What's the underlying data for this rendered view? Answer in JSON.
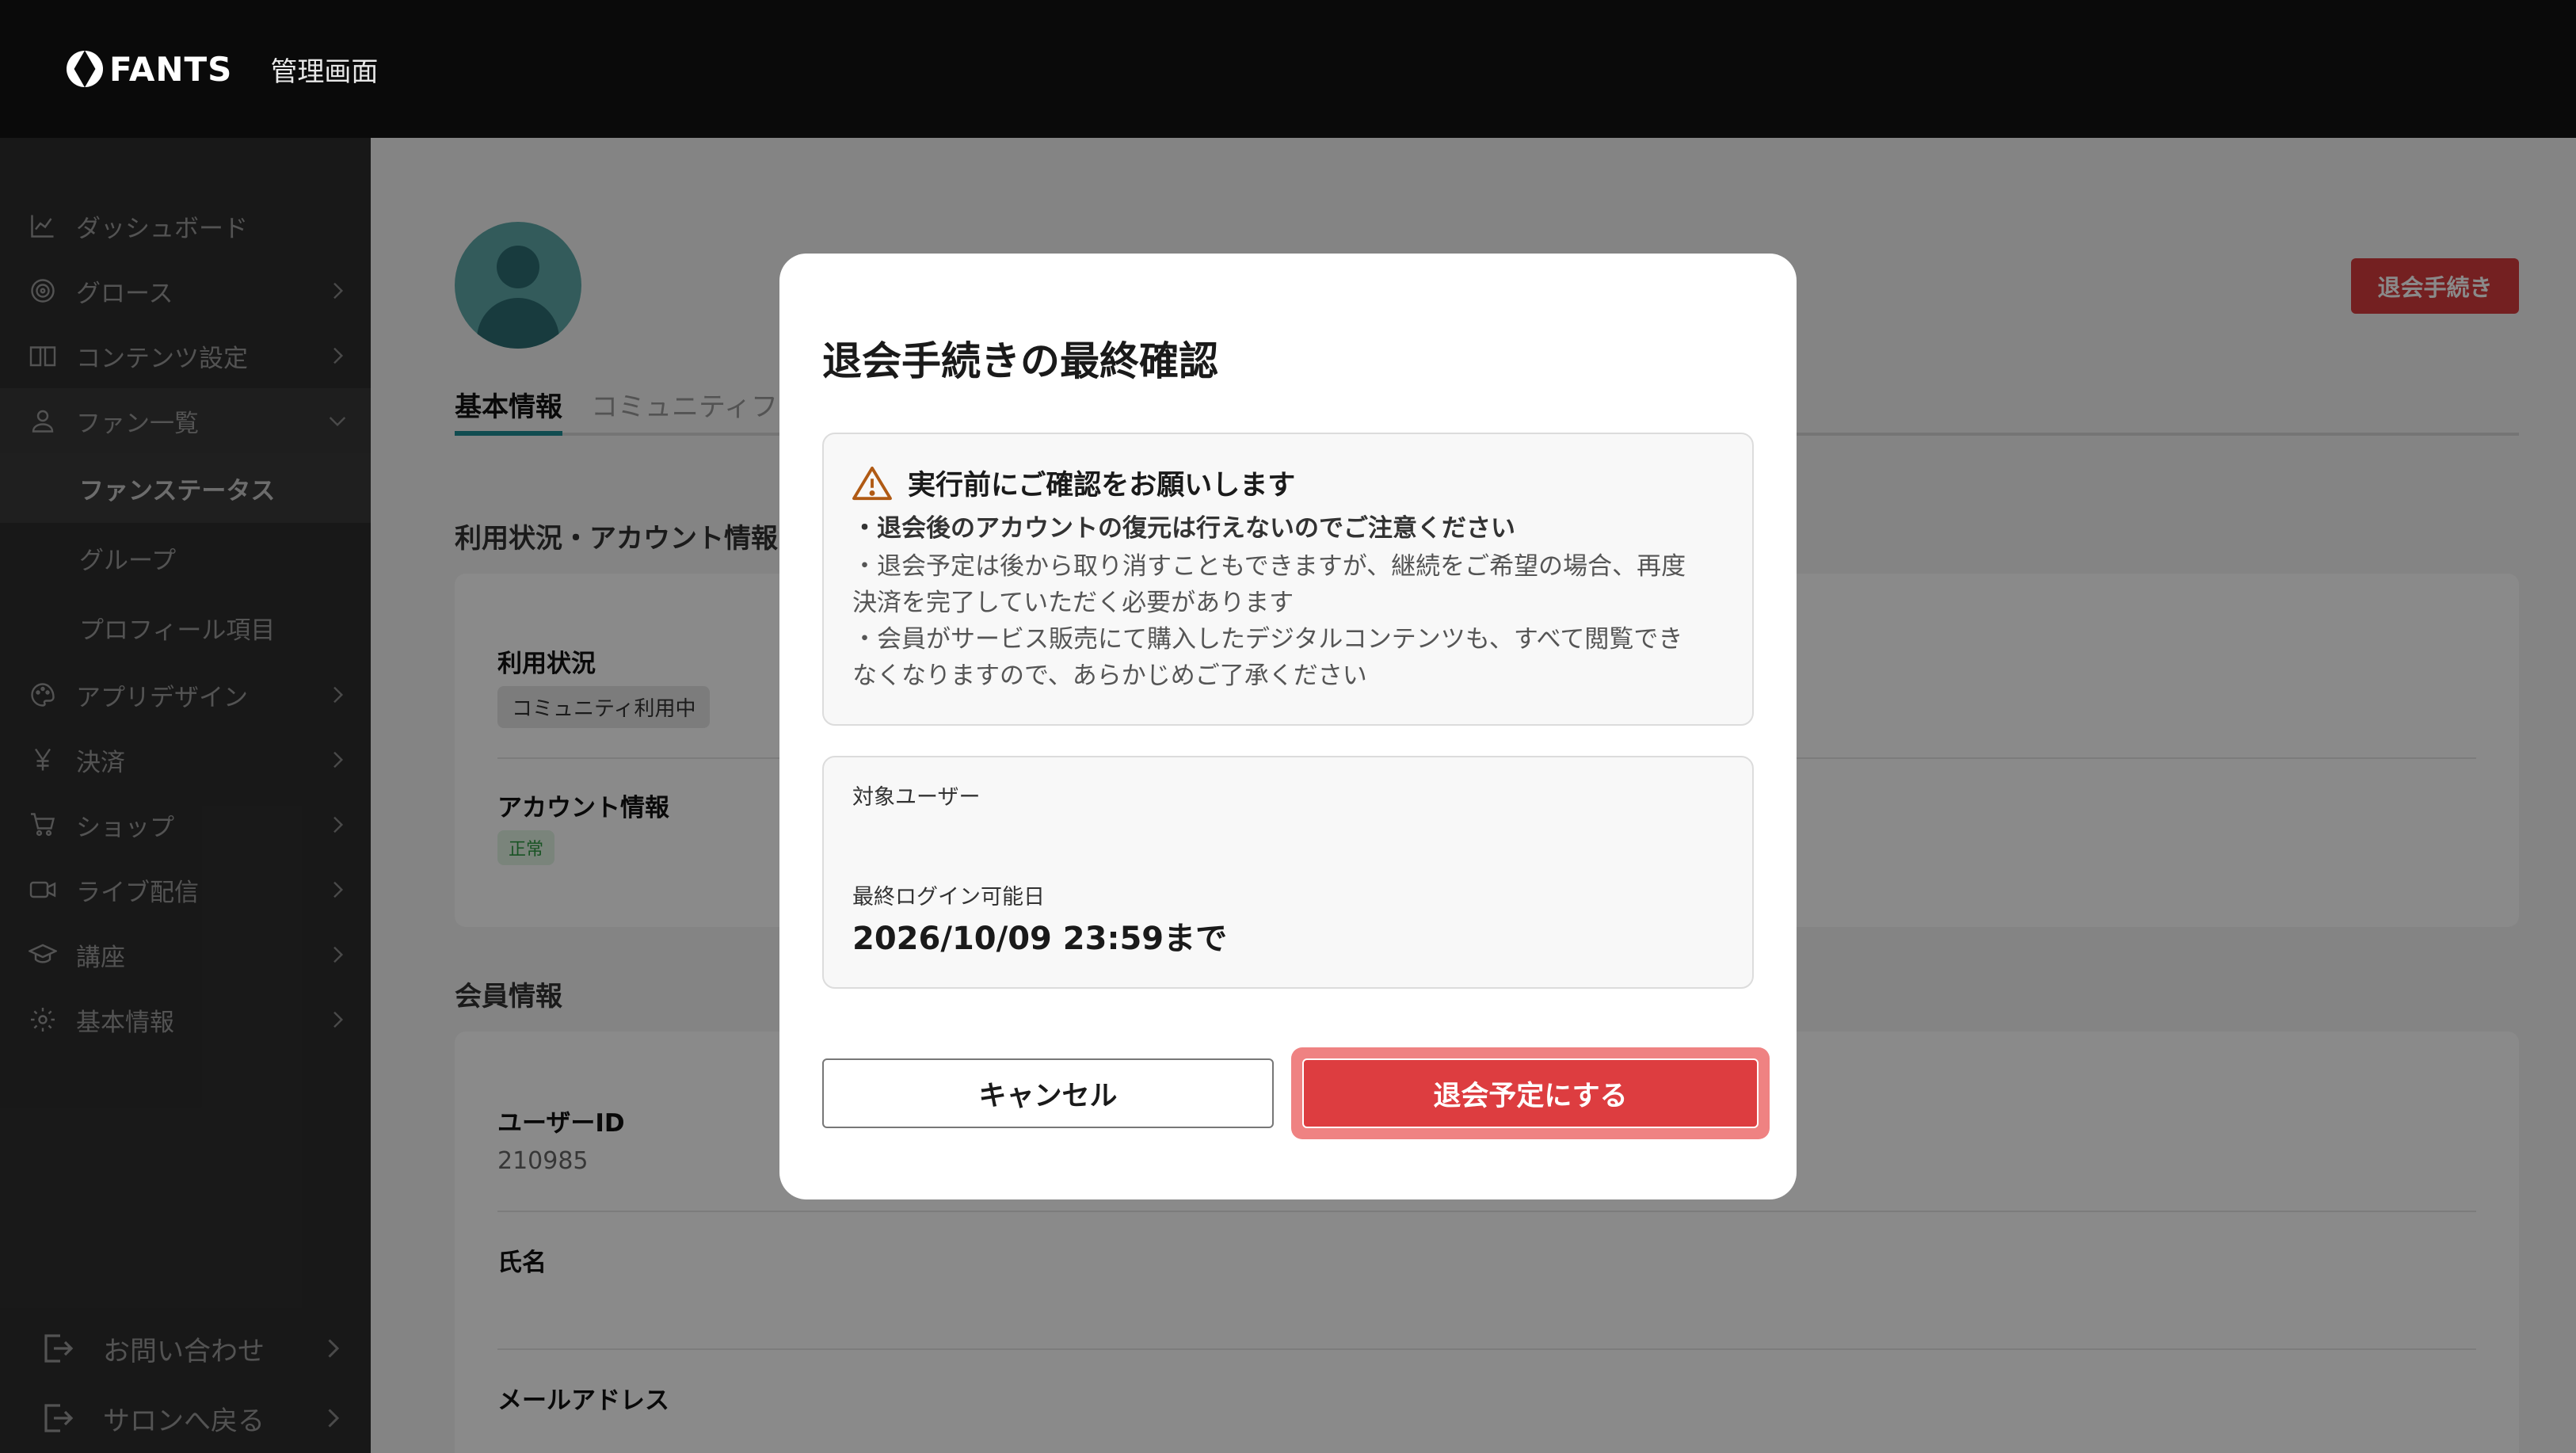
{
  "header": {
    "logo_text": "FANTS",
    "title": "管理画面"
  },
  "sidebar": {
    "items": [
      {
        "label": "ダッシュボード",
        "icon": "chart-line-icon",
        "has_chevron": false
      },
      {
        "label": "グロース",
        "icon": "target-icon",
        "has_chevron": true
      },
      {
        "label": "コンテンツ設定",
        "icon": "book-icon",
        "has_chevron": true
      },
      {
        "label": "ファン一覧",
        "icon": "user-icon",
        "has_chevron": true,
        "expanded": true
      },
      {
        "label": "アプリデザイン",
        "icon": "palette-icon",
        "has_chevron": true
      },
      {
        "label": "決済",
        "icon": "yen-icon",
        "has_chevron": true
      },
      {
        "label": "ショップ",
        "icon": "cart-icon",
        "has_chevron": true
      },
      {
        "label": "ライブ配信",
        "icon": "video-icon",
        "has_chevron": true
      },
      {
        "label": "講座",
        "icon": "graduation-cap-icon",
        "has_chevron": true
      },
      {
        "label": "基本情報",
        "icon": "gear-icon",
        "has_chevron": true
      }
    ],
    "sub_items": [
      "ファンステータス",
      "グループ",
      "プロフィール項目"
    ],
    "bottom_items": [
      "お問い合わせ",
      "サロンへ戻る"
    ]
  },
  "main": {
    "withdraw_button": "退会手続き",
    "tabs": [
      "基本情報",
      "コミュニティフ"
    ],
    "section_usage": "利用状況・アカウント情報",
    "usage_label": "利用状況",
    "usage_chip": "コミュニティ利用中",
    "account_label": "アカウント情報",
    "account_chip": "正常",
    "section_member": "会員情報",
    "user_id_label": "ユーザーID",
    "user_id_value": "210985",
    "name_label": "氏名",
    "email_label": "メールアドレス"
  },
  "modal": {
    "title": "退会手続きの最終確認",
    "warning_heading": "実行前にご確認をお願いします",
    "warning_lines": [
      "・退会後のアカウントの復元は行えないのでご注意ください",
      "・退会予定は後から取り消すこともできますが、継続をご希望の場合、再度",
      "決済を完了していただく必要があります",
      "・会員がサービス販売にて購入したデジタルコンテンツも、すべて閲覧でき",
      "なくなりますので、あらかじめご了承ください"
    ],
    "target_user_label": "対象ユーザー",
    "last_login_label": "最終ログイン可能日",
    "last_login_value": "2026/10/09 23:59まで",
    "cancel_label": "キャンセル",
    "confirm_label": "退会予定にする"
  },
  "colors": {
    "accent_red": "#dd3d40",
    "tab_accent": "#1f8d95",
    "topbar": "#0a0a0a",
    "sidebar": "#2e2e2e"
  }
}
